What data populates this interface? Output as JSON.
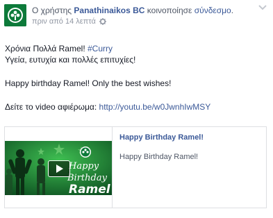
{
  "header": {
    "prefix": "Ο χρήστης",
    "page_name": "Panathinaikos BC",
    "action": "κοινοποίησε",
    "link_word": "σύνδεσμο",
    "suffix": ".",
    "timestamp": "πριν από 14 λεπτά"
  },
  "icons": {
    "avatar": "panathinaikos-logo",
    "privacy": "gear-icon",
    "menu": "chevron-down-icon",
    "play": "play-icon"
  },
  "post": {
    "line1_text": "Χρόνια Πολλά Ramel! ",
    "line1_hashtag": "#Curry",
    "line2": "Υγεία, ευτυχία και πολλές επιτυχίες!",
    "line3": "Happy birthday Ramel! Only the best wishes!",
    "line4_text": "Δείτε το video αφιέρωμα: ",
    "line4_url": "http://youtu.be/w0JwnhIwMSY"
  },
  "card": {
    "title": "Happy Birthday Ramel!",
    "description": "Happy Birthday Ramel!",
    "thumb_line1": "Happy",
    "thumb_line2": "Birthday",
    "thumb_line3": "Ramel"
  },
  "colors": {
    "link": "#3b5998",
    "brand_green": "#0d7a3a"
  }
}
